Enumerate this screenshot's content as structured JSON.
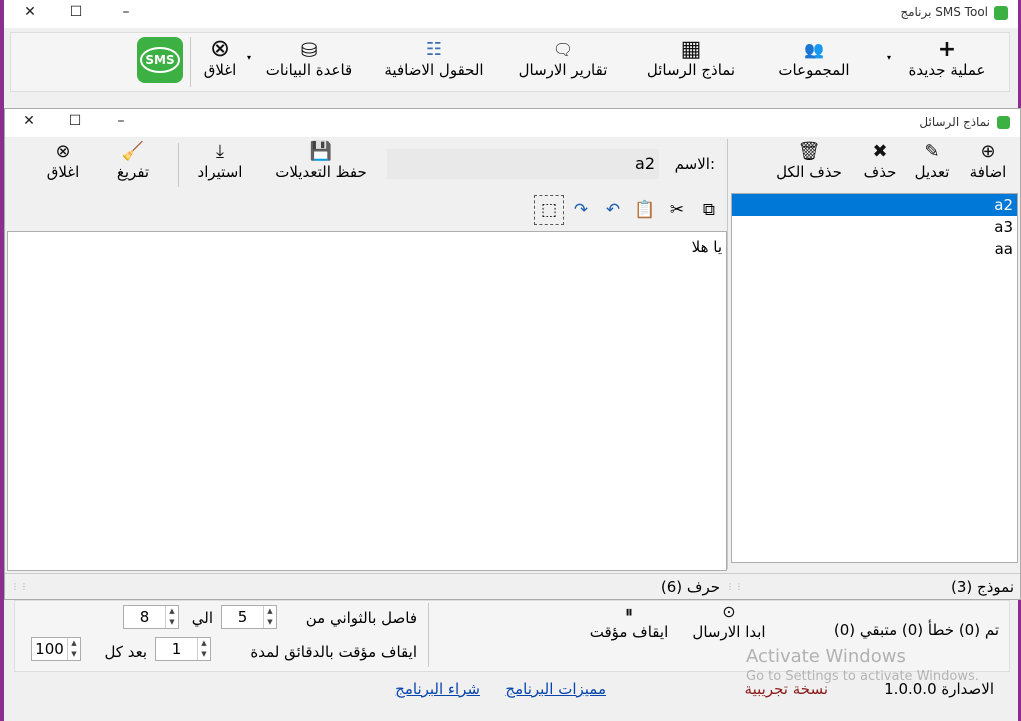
{
  "app": {
    "title": "برنامج SMS Tool",
    "toolbar": [
      {
        "label": "عملية جديدة",
        "icon": "plus-icon",
        "glyph": "+"
      },
      {
        "label": "المجموعات",
        "icon": "users-icon",
        "glyph": "👥"
      },
      {
        "label": "نماذج الرسائل",
        "icon": "templates-icon",
        "glyph": "▦"
      },
      {
        "label": "تقارير الارسال",
        "icon": "report-icon",
        "glyph": "🗨"
      },
      {
        "label": "الحقول الاضافية",
        "icon": "fields-icon",
        "glyph": "☷"
      },
      {
        "label": "قاعدة البيانات",
        "icon": "database-icon",
        "glyph": "⛁"
      },
      {
        "label": "اغلاق",
        "icon": "close-circle-icon",
        "glyph": "⊗"
      }
    ],
    "logo_text": "SMS"
  },
  "dialog": {
    "title": "نماذج الرسائل",
    "list_toolbar": [
      {
        "label": "اضافة",
        "icon": "add-circle-icon",
        "glyph": "⊕"
      },
      {
        "label": "تعديل",
        "icon": "edit-icon",
        "glyph": "✎"
      },
      {
        "label": "حذف",
        "icon": "delete-x-icon",
        "glyph": "✖"
      },
      {
        "label": "حذف الكل",
        "icon": "trash-icon",
        "glyph": "🗑"
      }
    ],
    "name_label": "الاسم:",
    "name_value": "a2",
    "editor_toolbar": [
      {
        "label": "حفظ التعديلات",
        "icon": "save-icon",
        "glyph": "💾"
      },
      {
        "label": "استيراد",
        "icon": "import-icon",
        "glyph": "⤓"
      },
      {
        "label": "تفريغ",
        "icon": "clear-icon",
        "glyph": "🧹"
      },
      {
        "label": "اغلاق",
        "icon": "close-circle-icon",
        "glyph": "⊗"
      }
    ],
    "edit_tools": [
      {
        "icon": "copy-icon",
        "glyph": "⧉"
      },
      {
        "icon": "cut-icon",
        "glyph": "✂"
      },
      {
        "icon": "paste-icon",
        "glyph": "📋"
      },
      {
        "icon": "undo-icon",
        "glyph": "↶"
      },
      {
        "icon": "redo-icon",
        "glyph": "↷"
      },
      {
        "icon": "select-icon",
        "glyph": "⬚"
      }
    ],
    "templates": [
      "a2",
      "a3",
      "aa"
    ],
    "selected_template": "a2",
    "editor_text": "يا هلا",
    "char_count": "(6) حرف",
    "template_count": "(3) نموذج"
  },
  "status": {
    "counts_text": "(0) تم  (0) خطأ  (0) متبقي",
    "start_send": "ابدا الارسال",
    "pause": "ايقاف مؤقت",
    "interval_label": "فاصل بالثواني من",
    "interval_from": "5",
    "interval_to_label": "الي",
    "interval_to": "8",
    "pause_label": "ايقاف مؤقت بالدقائق لمدة",
    "pause_minutes": "1",
    "every_label": "بعد كل",
    "every_count": "100"
  },
  "footer": {
    "version": "الاصدارة 1.0.0.0",
    "trial": "نسخة تجريبية",
    "features_link": "مميزات البرنامج",
    "buy_link": "شراء البرنامج"
  },
  "watermark": {
    "line1": "Activate Windows",
    "line2": "Go to Settings to activate Windows."
  },
  "colors": {
    "accent": "#0078d7",
    "logo": "#3cb043",
    "trial": "#8b1a1a",
    "link": "#0645ad"
  }
}
